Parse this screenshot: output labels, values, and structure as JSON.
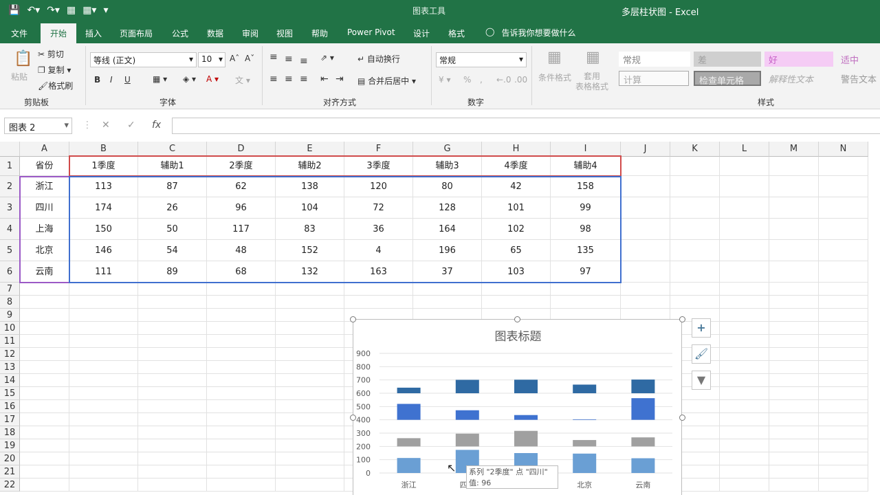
{
  "window": {
    "title": "多层柱状图  -  Excel",
    "context_tab": "图表工具"
  },
  "quick_access": {
    "icons": [
      "save-icon",
      "undo-icon",
      "redo-icon",
      "customize-icon"
    ]
  },
  "tabs": [
    "文件",
    "开始",
    "插入",
    "页面布局",
    "公式",
    "数据",
    "审阅",
    "视图",
    "帮助",
    "Power Pivot",
    "设计",
    "格式"
  ],
  "tell_me": "告诉我你想要做什么",
  "ribbon": {
    "clipboard": {
      "paste": "粘贴",
      "cut": "剪切",
      "copy": "复制",
      "format_painter": "格式刷",
      "label": "剪贴板"
    },
    "font": {
      "name": "等线 (正文)",
      "size": "10",
      "bold": "B",
      "italic": "I",
      "underline": "U",
      "label": "字体"
    },
    "alignment": {
      "wrap": "自动换行",
      "merge": "合并后居中",
      "label": "对齐方式"
    },
    "number": {
      "format": "常规",
      "percent": "%",
      "comma": ",",
      "label": "数字"
    },
    "styles": {
      "conditional": "条件格式",
      "table_format": "套用\n表格格式",
      "cells": [
        "常规",
        "差",
        "好",
        "适中",
        "计算",
        "检查单元格",
        "解释性文本",
        "警告文本"
      ],
      "label": "样式"
    }
  },
  "formula_bar": {
    "name_box": "图表 2",
    "fx": "fx",
    "value": ""
  },
  "sheet": {
    "columns": [
      "A",
      "B",
      "C",
      "D",
      "E",
      "F",
      "G",
      "H",
      "I",
      "J",
      "K",
      "L",
      "M",
      "N"
    ],
    "rows": [
      "1",
      "2",
      "3",
      "4",
      "5",
      "6",
      "7",
      "8",
      "9",
      "10",
      "11",
      "12",
      "13",
      "14",
      "15",
      "16",
      "17",
      "18",
      "19",
      "20",
      "21",
      "22"
    ],
    "header": [
      "省份",
      "1季度",
      "辅助1",
      "2季度",
      "辅助2",
      "3季度",
      "辅助3",
      "4季度",
      "辅助4"
    ],
    "data": [
      [
        "浙江",
        "113",
        "87",
        "62",
        "138",
        "120",
        "80",
        "42",
        "158"
      ],
      [
        "四川",
        "174",
        "26",
        "96",
        "104",
        "72",
        "128",
        "101",
        "99"
      ],
      [
        "上海",
        "150",
        "50",
        "117",
        "83",
        "36",
        "164",
        "102",
        "98"
      ],
      [
        "北京",
        "146",
        "54",
        "48",
        "152",
        "4",
        "196",
        "65",
        "135"
      ],
      [
        "云南",
        "111",
        "89",
        "68",
        "132",
        "163",
        "37",
        "103",
        "97"
      ]
    ]
  },
  "chart_data": {
    "type": "bar",
    "title": "图表标题",
    "categories": [
      "浙江",
      "四川",
      "上海",
      "北京",
      "云南"
    ],
    "stacked": true,
    "series": [
      {
        "name": "1季度",
        "values": [
          113,
          174,
          150,
          146,
          111
        ],
        "color": "#6a9fd4"
      },
      {
        "name": "辅助1",
        "values": [
          87,
          26,
          50,
          54,
          89
        ],
        "color": "none"
      },
      {
        "name": "2季度",
        "values": [
          62,
          96,
          117,
          48,
          68
        ],
        "color": "#a0a0a0"
      },
      {
        "name": "辅助2",
        "values": [
          138,
          104,
          83,
          152,
          132
        ],
        "color": "none"
      },
      {
        "name": "3季度",
        "values": [
          120,
          72,
          36,
          4,
          163
        ],
        "color": "#3f72d0"
      },
      {
        "name": "辅助3",
        "values": [
          80,
          128,
          164,
          196,
          37
        ],
        "color": "none"
      },
      {
        "name": "4季度",
        "values": [
          42,
          101,
          102,
          65,
          103
        ],
        "color": "#2f6aa3"
      },
      {
        "name": "辅助4",
        "values": [
          158,
          99,
          98,
          135,
          97
        ],
        "color": "none"
      }
    ],
    "ylim": [
      0,
      900
    ],
    "yticks": [
      "0",
      "100",
      "200",
      "300",
      "400",
      "500",
      "600",
      "700",
      "800",
      "900"
    ],
    "grid": true
  },
  "chart_tooltip": {
    "line1": "系列 \"2季度\" 点 \"四川\"",
    "line2": "值: 96"
  },
  "chart_side_buttons": [
    "add-element-icon",
    "brush-style-icon",
    "filter-icon"
  ]
}
